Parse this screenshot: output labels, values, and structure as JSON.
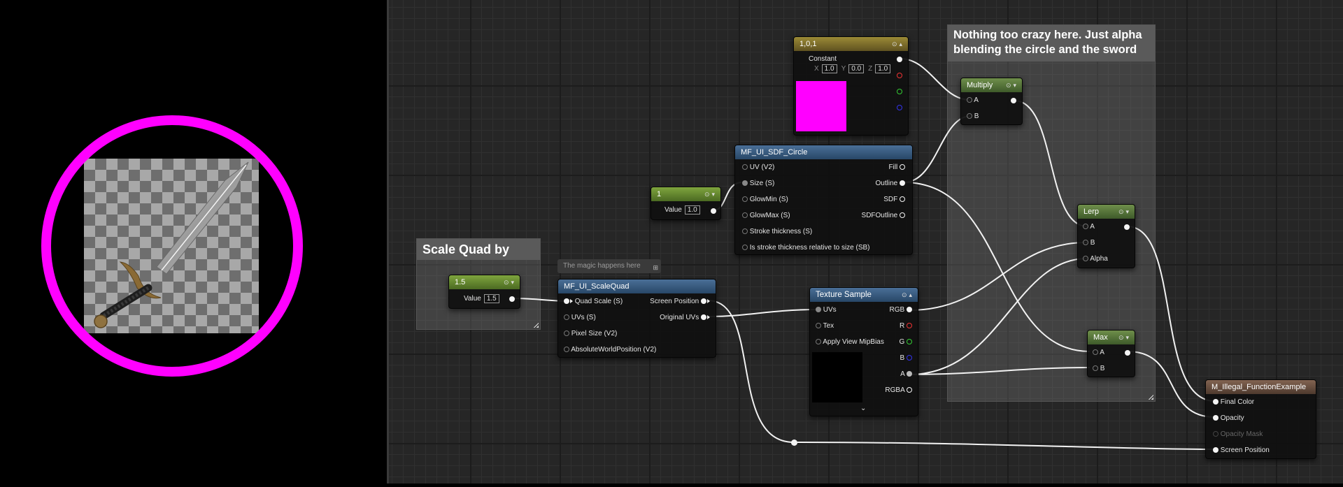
{
  "preview": {
    "ring_color": "#ff00ff",
    "icons": [
      "sword-icon",
      "checkerboard-transparency"
    ]
  },
  "comments": {
    "scale": "Scale Quad by",
    "blend": "Nothing too crazy here. Just alpha blending the circle and the sword"
  },
  "bubble": {
    "text": "The magic happens here"
  },
  "nodes": {
    "const3": {
      "title": "1,0,1",
      "label": "Constant",
      "x_lbl": "X",
      "x_val": "1.0",
      "y_lbl": "Y",
      "y_val": "0.0",
      "z_lbl": "Z",
      "z_val": "1.0",
      "swatch": "#ff00ff"
    },
    "multiply": {
      "title": "Multiply",
      "a": "A",
      "b": "B"
    },
    "sdf": {
      "title": "MF_UI_SDF_Circle",
      "inputs": [
        "UV (V2)",
        "Size (S)",
        "GlowMin (S)",
        "GlowMax (S)",
        "Stroke thickness (S)",
        "Is stroke thickness relative to size (SB)"
      ],
      "outputs": [
        "Fill",
        "Outline",
        "SDF",
        "SDFOutline"
      ]
    },
    "const1": {
      "title": "1",
      "value_label": "Value",
      "value": "1.0"
    },
    "scalequad": {
      "title": "MF_UI_ScaleQuad",
      "inputs": [
        "Quad Scale (S)",
        "UVs (S)",
        "Pixel Size (V2)",
        "AbsoluteWorldPosition (V2)"
      ],
      "outputs": [
        "Screen Position",
        "Original UVs"
      ]
    },
    "const15": {
      "title": "1.5",
      "value_label": "Value",
      "value": "1.5"
    },
    "texture": {
      "title": "Texture Sample",
      "inputs": [
        "UVs",
        "Tex",
        "Apply View MipBias"
      ],
      "outputs": [
        "RGB",
        "R",
        "G",
        "B",
        "A",
        "RGBA"
      ]
    },
    "lerp": {
      "title": "Lerp",
      "a": "A",
      "b": "B",
      "alpha": "Alpha"
    },
    "max": {
      "title": "Max",
      "a": "A",
      "b": "B"
    },
    "result": {
      "title": "M_Illegal_FunctionExample",
      "inputs": [
        "Final Color",
        "Opacity",
        "Opacity Mask",
        "Screen Position"
      ]
    }
  },
  "colors": {
    "header_green": "#5a7a3c",
    "header_blue": "#3a5a80",
    "header_yellow": "#8a7a30",
    "header_brown": "#6e5242",
    "wire": "#f2f2f2",
    "graph_bg": "#262626"
  }
}
